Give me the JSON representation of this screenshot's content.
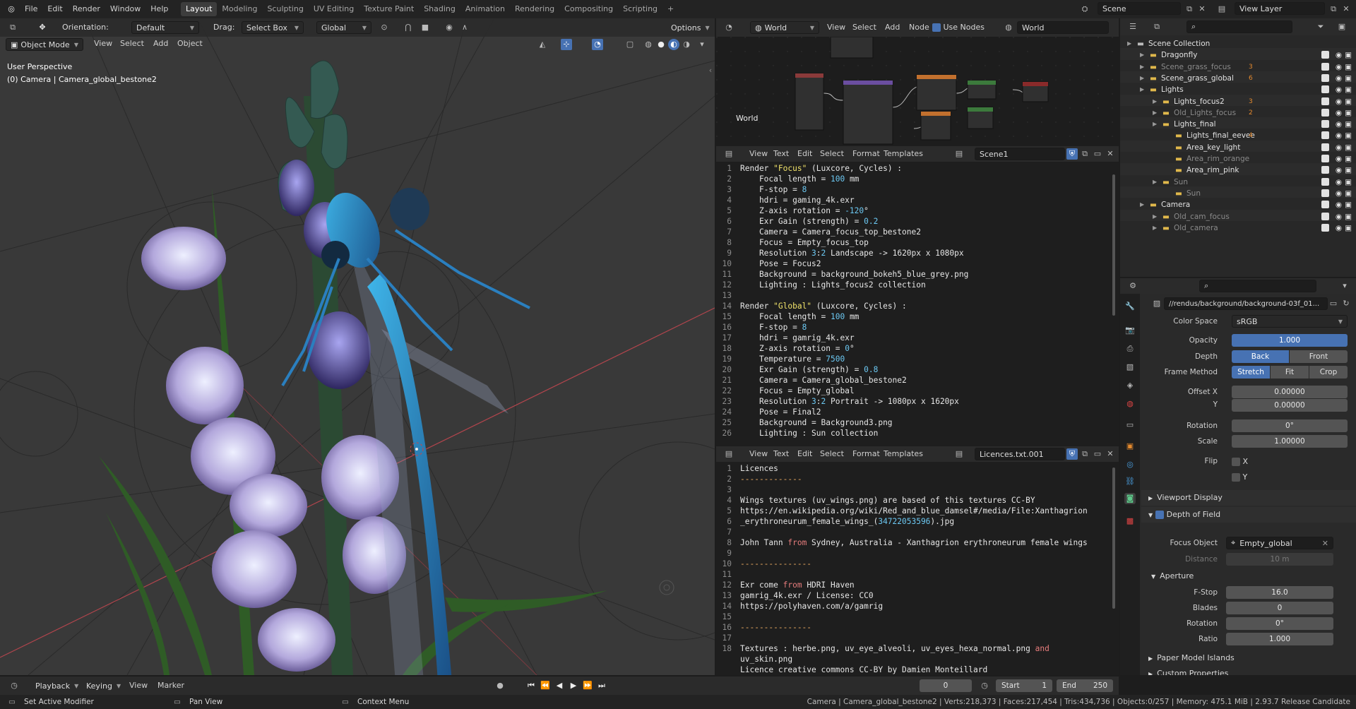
{
  "menu": {
    "items": [
      "File",
      "Edit",
      "Render",
      "Window",
      "Help"
    ]
  },
  "workspaces": {
    "tabs": [
      "Layout",
      "Modeling",
      "Sculpting",
      "UV Editing",
      "Texture Paint",
      "Shading",
      "Animation",
      "Rendering",
      "Compositing",
      "Scripting"
    ],
    "active": "Layout"
  },
  "topright": {
    "scene": "Scene",
    "view_layer": "View Layer"
  },
  "viewport_header": {
    "orientation_label": "Orientation:",
    "orientation_value": "Default",
    "drag_label": "Drag:",
    "drag_value": "Select Box",
    "transform": "Global",
    "options": "Options",
    "mode": "Object Mode",
    "menu": [
      "View",
      "Select",
      "Add",
      "Object"
    ]
  },
  "viewport": {
    "perspective": "User Perspective",
    "object": "(0) Camera | Camera_global_bestone2"
  },
  "node_editor": {
    "world_dd": "World",
    "menu": [
      "View",
      "Select",
      "Add",
      "Node"
    ],
    "use_nodes": "Use Nodes",
    "world_name": "World",
    "label": "World"
  },
  "text_editor_1": {
    "menu": [
      "View",
      "Text",
      "Edit",
      "Select",
      "Format",
      "Templates"
    ],
    "filename": "Scene1",
    "lines": [
      "Render \"Focus\" (Luxcore, Cycles) :",
      "    Focal length = 100 mm",
      "    F-stop = 8",
      "    hdri = gaming_4k.exr",
      "    Z-axis rotation = -120°",
      "    Exr Gain (strength) = 0.2",
      "    Camera = Camera_focus_top_bestone2",
      "    Focus = Empty_focus_top",
      "    Resolution 3:2 Landscape -> 1620px x 1080px",
      "    Pose = Focus2",
      "    Background = background_bokeh5_blue_grey.png",
      "    Lighting : Lights_focus2 collection",
      "",
      "Render \"Global\" (Luxcore, Cycles) :",
      "    Focal length = 100 mm",
      "    F-stop = 8",
      "    hdri = gamrig_4k.exr",
      "    Z-axis rotation = 0°",
      "    Temperature = 7500",
      "    Exr Gain (strength) = 0.8",
      "    Camera = Camera_global_bestone2",
      "    Focus = Empty_global",
      "    Resolution 3:2 Portrait -> 1080px x 1620px",
      "    Pose = Final2",
      "    Background = Background3.png",
      "    Lighting : Sun collection"
    ]
  },
  "text_editor_2": {
    "menu": [
      "View",
      "Text",
      "Edit",
      "Select",
      "Format",
      "Templates"
    ],
    "filename": "Licences.txt.001",
    "lines": [
      "Licences",
      "-------------",
      "",
      "Wings textures (uv_wings.png) are based of this textures CC-BY",
      "https://en.wikipedia.org/wiki/Red_and_blue_damsel#/media/File:Xanthagrion",
      "_erythroneurum_female_wings_(34722053596).jpg",
      "",
      "John Tann from Sydney, Australia - Xanthagrion erythroneurum female wings",
      "",
      "---------------",
      "",
      "Exr come from HDRI Haven",
      "gamrig_4k.exr / License: CC0",
      "https://polyhaven.com/a/gamrig",
      "",
      "---------------",
      "",
      "Textures : herbe.png, uv_eye_alveoli, uv_eyes_hexa_normal.png and",
      "uv_skin.png",
      "Licence creative commons CC-BY by Damien Monteillard"
    ],
    "line_numbers": [
      "1",
      "2",
      "3",
      "4",
      "5",
      "",
      "6",
      "7",
      "8",
      "9",
      "10",
      "11",
      "12",
      "13",
      "14",
      "15",
      "16",
      "17",
      "",
      "18"
    ]
  },
  "outliner": {
    "items": [
      {
        "label": "Scene Collection",
        "indent": 0
      },
      {
        "label": "Dragonfly",
        "indent": 1
      },
      {
        "label": "Scene_grass_focus",
        "indent": 1,
        "count": "3"
      },
      {
        "label": "Scene_grass_global",
        "indent": 1,
        "count": "6"
      },
      {
        "label": "Lights",
        "indent": 1
      },
      {
        "label": "Lights_focus2",
        "indent": 2,
        "count": "3"
      },
      {
        "label": "Old_Lights_focus",
        "indent": 2,
        "count": "2"
      },
      {
        "label": "Lights_final",
        "indent": 2
      },
      {
        "label": "Lights_final_eevee",
        "indent": 3,
        "count": "4"
      },
      {
        "label": "Area_key_light",
        "indent": 3
      },
      {
        "label": "Area_rim_orange",
        "indent": 3
      },
      {
        "label": "Area_rim_pink",
        "indent": 3
      },
      {
        "label": "Sun",
        "indent": 2
      },
      {
        "label": "Sun",
        "indent": 3
      },
      {
        "label": "Camera",
        "indent": 1
      },
      {
        "label": "Old_cam_focus",
        "indent": 2
      },
      {
        "label": "Old_camera",
        "indent": 2
      }
    ]
  },
  "properties": {
    "image_path": "//rendus/background/background-03f_01...",
    "color_space_label": "Color Space",
    "color_space": "sRGB",
    "opacity_label": "Opacity",
    "opacity": "1.000",
    "depth_label": "Depth",
    "depth_back": "Back",
    "depth_front": "Front",
    "frame_method_label": "Frame Method",
    "fm_stretch": "Stretch",
    "fm_fit": "Fit",
    "fm_crop": "Crop",
    "offset_x_label": "Offset X",
    "offset_x": "0.00000",
    "offset_y_label": "Y",
    "offset_y": "0.00000",
    "rotation_label": "Rotation",
    "rotation": "0°",
    "scale_label": "Scale",
    "scale": "1.00000",
    "flip_label": "Flip",
    "flip_x": "X",
    "flip_y": "Y",
    "viewport_display": "Viewport Display",
    "dof": "Depth of Field",
    "focus_object_label": "Focus Object",
    "focus_object": "Empty_global",
    "distance_label": "Distance",
    "distance": "10 m",
    "aperture": "Aperture",
    "fstop_label": "F-Stop",
    "fstop": "16.0",
    "blades_label": "Blades",
    "blades": "0",
    "ap_rotation_label": "Rotation",
    "ap_rotation": "0°",
    "ratio_label": "Ratio",
    "ratio": "1.000",
    "paper_model": "Paper Model Islands",
    "custom_props": "Custom Properties"
  },
  "timeline": {
    "menu": [
      "Playback",
      "Keying",
      "View",
      "Marker"
    ],
    "current": "0",
    "start_label": "Start",
    "start": "1",
    "end_label": "End",
    "end": "250"
  },
  "statusbar": {
    "left1": "Set Active Modifier",
    "left2": "Pan View",
    "left3": "Context Menu",
    "right": "Camera | Camera_global_bestone2 | Verts:218,373 | Faces:217,454 | Tris:434,736 | Objects:0/257 | Memory: 475.1 MiB | 2.93.7 Release Candidate"
  },
  "colors": {
    "accent": "#4772b3",
    "header": "#2b2b2b",
    "editor_bg": "#1e1e1e",
    "viewport_bg": "#3a3a3a"
  }
}
